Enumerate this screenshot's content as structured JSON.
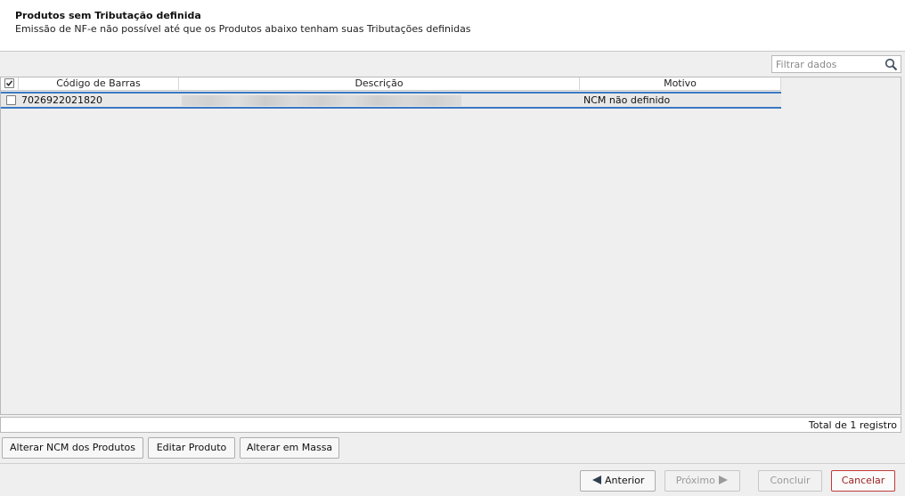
{
  "header": {
    "title": "Produtos sem Tributação definida",
    "subtitle": "Emissão de NF-e não possível até que os Produtos abaixo tenham suas Tributações definidas"
  },
  "filter": {
    "placeholder": "Filtrar dados",
    "icon": "search-icon"
  },
  "table": {
    "columns": [
      "Código de Barras",
      "Descrição",
      "Motivo"
    ],
    "header_checkbox_checked": true,
    "rows": [
      {
        "checked": false,
        "codigo_barras": "7026922021820",
        "descricao": "",
        "motivo": "NCM não definido"
      }
    ]
  },
  "footer": {
    "total": "Total de 1 registro"
  },
  "actions": {
    "alterar_ncm": "Alterar NCM dos Produtos",
    "editar_produto": "Editar Produto",
    "alterar_massa": "Alterar em Massa"
  },
  "navigation": {
    "anterior": "Anterior",
    "proximo": "Próximo",
    "concluir": "Concluir",
    "cancelar": "Cancelar"
  },
  "colors": {
    "selection_border": "#3a78c2",
    "cancel_border": "#c23a3a",
    "nav_arrow_active": "#2f3f52",
    "nav_arrow_disabled": "#9a9a9a"
  }
}
